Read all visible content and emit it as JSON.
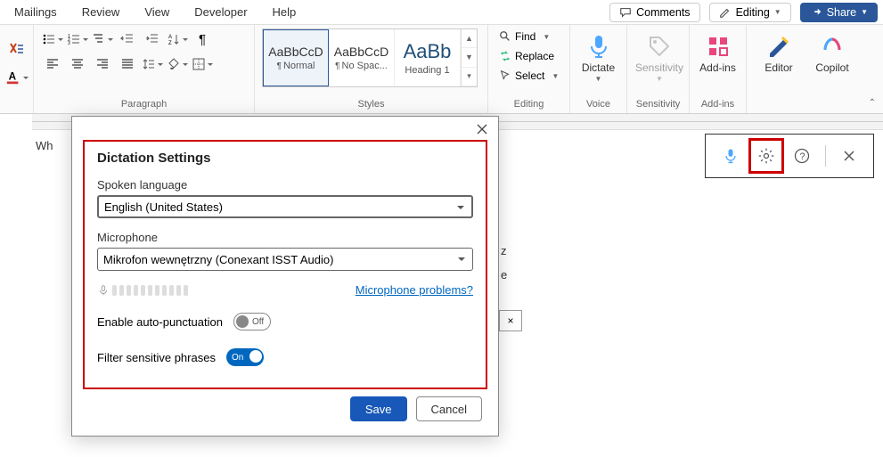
{
  "menu": {
    "mailings": "Mailings",
    "review": "Review",
    "view": "View",
    "developer": "Developer",
    "help": "Help"
  },
  "top_buttons": {
    "comments": "Comments",
    "editing": "Editing",
    "share": "Share"
  },
  "ribbon": {
    "paragraph_label": "Paragraph",
    "styles_label": "Styles",
    "editing_label": "Editing",
    "voice_label": "Voice",
    "sensitivity_label": "Sensitivity",
    "addins_label": "Add-ins",
    "styles": {
      "normal_preview": "AaBbCcD",
      "normal_name": "Normal",
      "nospacing_preview": "AaBbCcD",
      "nospacing_name": "No Spac...",
      "heading1_preview": "AaBb",
      "heading1_name": "Heading 1"
    },
    "editing_items": {
      "find": "Find",
      "replace": "Replace",
      "select": "Select"
    },
    "dictate": "Dictate",
    "sensitivity": "Sensitivity",
    "addins": "Add-ins",
    "editor": "Editor",
    "copilot": "Copilot"
  },
  "doc": {
    "leading": "Wh"
  },
  "side_fragments": {
    "a": "z",
    "b": "e",
    "c": "×"
  },
  "dialog": {
    "title": "Dictation Settings",
    "spoken_language_label": "Spoken language",
    "spoken_language_value": "English (United States)",
    "microphone_label": "Microphone",
    "microphone_value": "Mikrofon wewnętrzny (Conexant ISST Audio)",
    "mic_problems": "Microphone problems?",
    "auto_punct_label": "Enable auto-punctuation",
    "auto_punct_state": "Off",
    "filter_label": "Filter sensitive phrases",
    "filter_state": "On",
    "save": "Save",
    "cancel": "Cancel"
  }
}
